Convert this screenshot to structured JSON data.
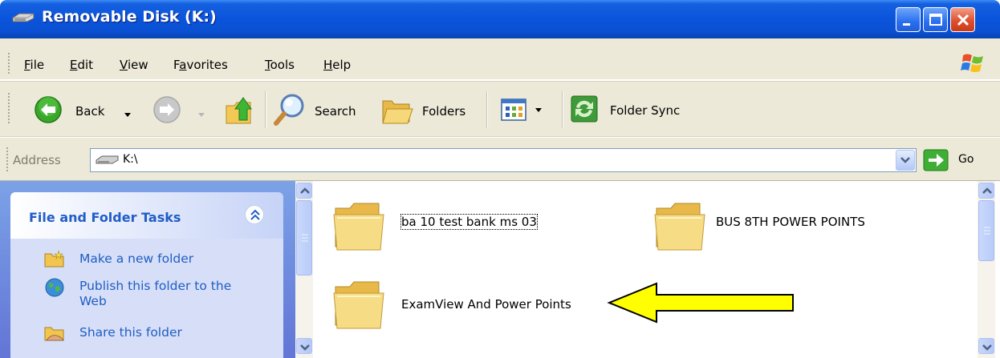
{
  "window": {
    "title": "Removable Disk (K:)",
    "controls": [
      "minimize",
      "maximize",
      "close"
    ]
  },
  "menu": {
    "items": [
      {
        "label": "File",
        "key": "F",
        "rest": "ile"
      },
      {
        "label": "Edit",
        "key": "E",
        "rest": "dit"
      },
      {
        "label": "View",
        "key": "V",
        "rest": "iew"
      },
      {
        "label": "Favorites",
        "key": "a",
        "pre": "F",
        "rest": "vorites"
      },
      {
        "label": "Tools",
        "key": "T",
        "rest": "ools"
      },
      {
        "label": "Help",
        "key": "H",
        "rest": "elp"
      }
    ]
  },
  "toolbar": {
    "back_label": "Back",
    "search_label": "Search",
    "folders_label": "Folders",
    "folder_sync_label": "Folder Sync"
  },
  "address": {
    "label": "Address",
    "value": "K:\\",
    "go_label": "Go"
  },
  "taskpane": {
    "title": "File and Folder Tasks",
    "tasks": [
      {
        "label": "Make a new folder"
      },
      {
        "label": "Publish this folder to the Web"
      },
      {
        "label": "Share this folder"
      }
    ]
  },
  "files": [
    {
      "name": "ba 10 test bank ms 03",
      "selected": true
    },
    {
      "name": "BUS 8TH POWER POINTS",
      "selected": false
    },
    {
      "name": "ExamView And Power Points",
      "selected": false
    }
  ],
  "colors": {
    "titlebar": "#0a54dc",
    "taskpane_bg": "#6375d6",
    "task_link": "#215dc6",
    "arrow_fill": "#ffff00"
  }
}
